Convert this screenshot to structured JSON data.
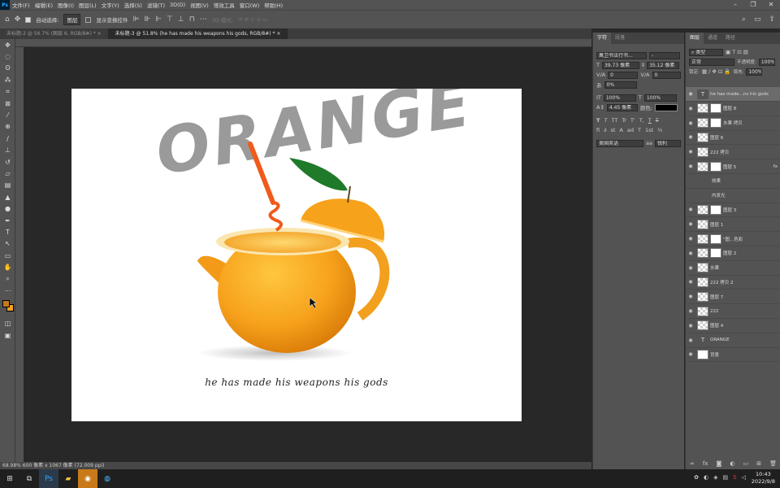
{
  "menubar": {
    "logo": "Ps",
    "items": [
      "文件(F)",
      "编辑(E)",
      "图像(I)",
      "图层(L)",
      "文字(Y)",
      "选择(S)",
      "滤镜(T)",
      "3D(D)",
      "视图(V)",
      "增效工具",
      "窗口(W)",
      "帮助(H)"
    ]
  },
  "options": {
    "auto_select_label": "自动选择:",
    "auto_select_value": "图层",
    "show_transform_label": "显示变换控件",
    "mode_3d_label": "3D 模式:"
  },
  "tabs": [
    {
      "label": "未标题-2 @ 56.7% (图层 6, RGB/8#) *",
      "active": false
    },
    {
      "label": "未标题-3 @ 51.8% (he has made his weapons his gods, RGB/8#) *",
      "active": true
    }
  ],
  "canvas": {
    "title_text": "ORANGE",
    "subtitle_text": "he has made his weapons his gods"
  },
  "status": {
    "text": "68.98%   600 像素 x 1067 像素 (72.009 ppi)"
  },
  "char_panel": {
    "tabs": [
      "字符",
      "段落"
    ],
    "font_family": "萬卫书法行书...",
    "font_style": "-",
    "font_size": "39.73 像素",
    "leading": "35.12 像素",
    "kerning": "0",
    "tracking": "0",
    "vscale_pct": "0%",
    "hscale": "100%",
    "vscale": "100%",
    "baseline": "4.45 像素",
    "color_label": "颜色:",
    "language": "美国英语",
    "antialias": "锐利",
    "style_buttons": [
      "T",
      "T",
      "TT",
      "Tr",
      "T'",
      "T,",
      "T",
      "T"
    ],
    "opentype_buttons": [
      "fi",
      "∂",
      "st",
      "A",
      "ad",
      "T",
      "1st",
      "½"
    ]
  },
  "layers_panel": {
    "tabs": [
      "图层",
      "通道",
      "路径"
    ],
    "filter_kind": "类型",
    "blend_mode": "正常",
    "opacity_label": "不透明度:",
    "opacity": "100%",
    "lock_label": "锁定:",
    "fill_label": "填充:",
    "fill": "100%",
    "layers": [
      {
        "name": "he has made...ns his gods",
        "thumb": "text",
        "selected": true
      },
      {
        "name": "图层 8",
        "thumb": "mask",
        "selected": false
      },
      {
        "name": "水果 拷贝",
        "thumb": "mask",
        "selected": false
      },
      {
        "name": "图层 6",
        "thumb": "checker",
        "selected": false
      },
      {
        "name": "222 拷贝",
        "thumb": "checker",
        "selected": false
      },
      {
        "name": "图层 5",
        "thumb": "mask",
        "selected": false,
        "fx": "fx"
      },
      {
        "name": "效果",
        "thumb": "none",
        "selected": false
      },
      {
        "name": "内发光",
        "thumb": "none",
        "selected": false
      },
      {
        "name": "图层 3",
        "thumb": "mask",
        "selected": false
      },
      {
        "name": "图层 1",
        "thumb": "checker",
        "selected": false
      },
      {
        "name": "\"图...色彩",
        "thumb": "mask",
        "selected": false
      },
      {
        "name": "图层 2",
        "thumb": "mask",
        "selected": false
      },
      {
        "name": "水果",
        "thumb": "checker",
        "selected": false
      },
      {
        "name": "222 拷贝 2",
        "thumb": "checker",
        "selected": false
      },
      {
        "name": "图层 7",
        "thumb": "checker",
        "selected": false
      },
      {
        "name": "222",
        "thumb": "checker",
        "selected": false
      },
      {
        "name": "图层 4",
        "thumb": "checker",
        "selected": false
      },
      {
        "name": "ORANGE",
        "thumb": "text",
        "selected": false
      },
      {
        "name": "背景",
        "thumb": "white",
        "selected": false
      }
    ]
  },
  "taskbar": {
    "time": "10:43",
    "date": "2022/9/8"
  },
  "colors": {
    "foreground": "#c87a1a",
    "background": "#f4a020",
    "char_color": "#000000"
  }
}
